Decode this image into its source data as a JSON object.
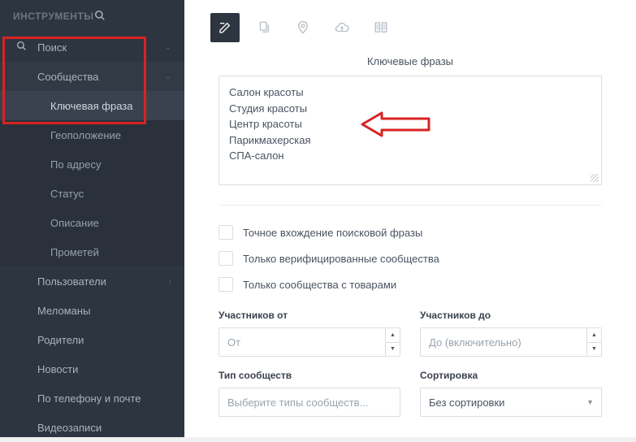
{
  "sidebar": {
    "title": "ИНСТРУМЕНТЫ",
    "items": [
      {
        "label": "Поиск"
      },
      {
        "label": "Сообщества"
      },
      {
        "label": "Ключевая фраза"
      },
      {
        "label": "Геоположение"
      },
      {
        "label": "По адресу"
      },
      {
        "label": "Статус"
      },
      {
        "label": "Описание"
      },
      {
        "label": "Прометей"
      },
      {
        "label": "Пользователи"
      },
      {
        "label": "Меломаны"
      },
      {
        "label": "Родители"
      },
      {
        "label": "Новости"
      },
      {
        "label": "По телефону и почте"
      },
      {
        "label": "Видеозаписи"
      }
    ]
  },
  "main": {
    "section_title": "Ключевые фразы",
    "textarea_value": "Салон красоты\nСтудия красоты\nЦентр красоты\nПарикмахерская\nСПА-салон",
    "checkboxes": [
      {
        "label": "Точное вхождение поисковой фразы"
      },
      {
        "label": "Только верифицированные сообщества"
      },
      {
        "label": "Только сообщества с товарами"
      }
    ],
    "filters": {
      "from_label": "Участников от",
      "from_placeholder": "От",
      "to_label": "Участников до",
      "to_placeholder": "До (включительно)",
      "type_label": "Тип сообществ",
      "type_placeholder": "Выберите типы сообществ...",
      "sort_label": "Сортировка",
      "sort_value": "Без сортировки"
    }
  }
}
